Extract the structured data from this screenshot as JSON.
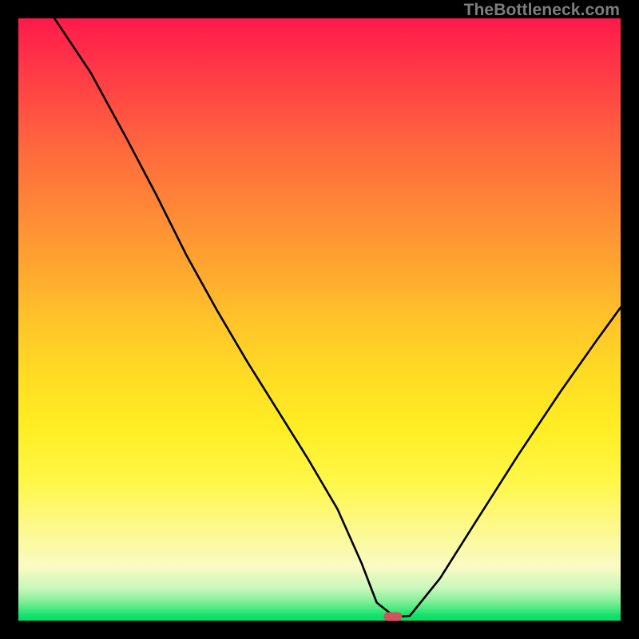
{
  "watermark": "TheBottleneck.com",
  "marker": {
    "x_pct": 62.2,
    "y_pct": 99.35
  },
  "chart_data": {
    "type": "line",
    "title": "",
    "xlabel": "",
    "ylabel": "",
    "xlim": [
      0,
      100
    ],
    "ylim": [
      0,
      100
    ],
    "series": [
      {
        "name": "bottleneck-curve",
        "x": [
          6.0,
          12.0,
          18.0,
          23.0,
          28.0,
          33.0,
          38.0,
          43.0,
          48.0,
          53.0,
          57.0,
          59.5,
          62.5,
          65.0,
          70.0,
          76.0,
          83.0,
          90.0,
          96.0,
          100.0
        ],
        "y": [
          100.0,
          91.0,
          80.0,
          70.5,
          60.5,
          51.5,
          43.0,
          35.0,
          27.0,
          18.5,
          9.5,
          3.0,
          0.6,
          0.8,
          7.0,
          16.5,
          27.5,
          38.0,
          46.5,
          52.0
        ]
      }
    ],
    "gradient_stops": [
      {
        "pct": 0,
        "color": "#ff1a49"
      },
      {
        "pct": 50,
        "color": "#ffc32a"
      },
      {
        "pct": 85,
        "color": "#fdf98f"
      },
      {
        "pct": 100,
        "color": "#00df66"
      }
    ],
    "marker": {
      "x": 62.2,
      "y": 0.65,
      "color": "#d0535e"
    }
  }
}
